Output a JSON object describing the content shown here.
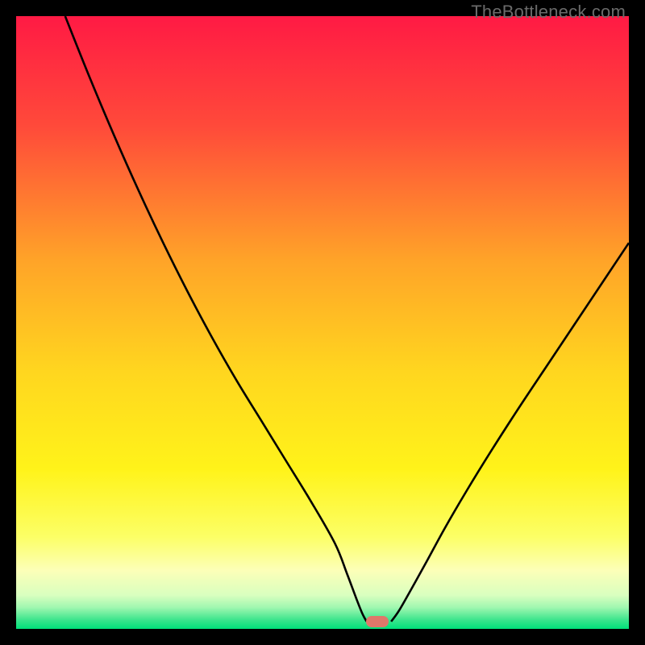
{
  "watermark": "TheBottleneck.com",
  "chart_data": {
    "type": "line",
    "title": "",
    "xlabel": "",
    "ylabel": "",
    "xlim": [
      0,
      100
    ],
    "ylim": [
      0,
      100
    ],
    "grid": false,
    "legend": false,
    "background_gradient_stops": [
      {
        "offset": 0.0,
        "color": "#ff1a44"
      },
      {
        "offset": 0.18,
        "color": "#ff4a3a"
      },
      {
        "offset": 0.4,
        "color": "#ffa428"
      },
      {
        "offset": 0.58,
        "color": "#ffd61f"
      },
      {
        "offset": 0.74,
        "color": "#fff31a"
      },
      {
        "offset": 0.85,
        "color": "#fcff66"
      },
      {
        "offset": 0.905,
        "color": "#fcffb8"
      },
      {
        "offset": 0.945,
        "color": "#d9ffbf"
      },
      {
        "offset": 0.965,
        "color": "#a0f7b0"
      },
      {
        "offset": 0.985,
        "color": "#3de58d"
      },
      {
        "offset": 1.0,
        "color": "#00e07a"
      }
    ],
    "series": [
      {
        "name": "curve-left",
        "stroke": "#000000",
        "x": [
          8,
          12,
          16,
          20,
          24,
          28,
          32,
          36,
          40,
          44,
          48,
          52,
          54,
          55.5,
          56.5,
          57.2
        ],
        "y": [
          100,
          90,
          80.5,
          71.5,
          63,
          55,
          47.5,
          40.5,
          34,
          27.5,
          21,
          14,
          9,
          5,
          2.5,
          1.2
        ]
      },
      {
        "name": "curve-right",
        "stroke": "#000000",
        "x": [
          61.2,
          62.5,
          64.5,
          67,
          70,
          73.5,
          77.5,
          82,
          87,
          92,
          97,
          100
        ],
        "y": [
          1.2,
          3,
          6.5,
          11,
          16.5,
          22.5,
          29,
          36,
          43.5,
          51,
          58.5,
          63
        ]
      }
    ],
    "marker": {
      "x": 59,
      "y": 1.2,
      "color": "#e0776a"
    }
  }
}
